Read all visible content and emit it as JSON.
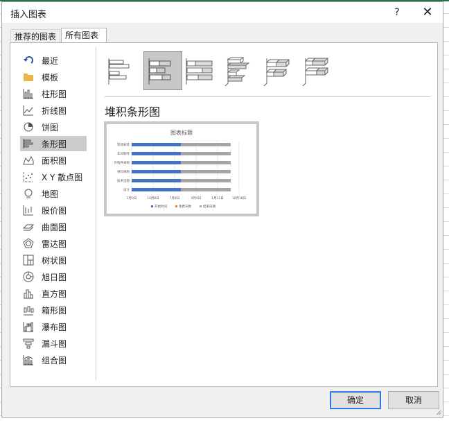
{
  "dialog": {
    "title": "插入图表",
    "help_label": "?",
    "close_label": "✕"
  },
  "tabs": [
    {
      "label": "推荐的图表",
      "active": false
    },
    {
      "label": "所有图表",
      "active": true
    }
  ],
  "categories": [
    {
      "label": "最近",
      "icon": "recent-icon"
    },
    {
      "label": "模板",
      "icon": "folder-icon"
    },
    {
      "label": "柱形图",
      "icon": "column-chart-icon"
    },
    {
      "label": "折线图",
      "icon": "line-chart-icon"
    },
    {
      "label": "饼图",
      "icon": "pie-chart-icon"
    },
    {
      "label": "条形图",
      "icon": "bar-chart-icon",
      "selected": true
    },
    {
      "label": "面积图",
      "icon": "area-chart-icon"
    },
    {
      "label": "X Y 散点图",
      "icon": "scatter-chart-icon"
    },
    {
      "label": "地图",
      "icon": "map-chart-icon"
    },
    {
      "label": "股价图",
      "icon": "stock-chart-icon"
    },
    {
      "label": "曲面图",
      "icon": "surface-chart-icon"
    },
    {
      "label": "雷达图",
      "icon": "radar-chart-icon"
    },
    {
      "label": "树状图",
      "icon": "treemap-chart-icon"
    },
    {
      "label": "旭日图",
      "icon": "sunburst-chart-icon"
    },
    {
      "label": "直方图",
      "icon": "histogram-chart-icon"
    },
    {
      "label": "箱形图",
      "icon": "box-whisker-chart-icon"
    },
    {
      "label": "瀑布图",
      "icon": "waterfall-chart-icon"
    },
    {
      "label": "漏斗图",
      "icon": "funnel-chart-icon"
    },
    {
      "label": "组合图",
      "icon": "combo-chart-icon"
    }
  ],
  "subtypes": [
    {
      "name": "clustered-bar",
      "selected": false
    },
    {
      "name": "stacked-bar",
      "selected": true
    },
    {
      "name": "100-stacked-bar",
      "selected": false
    },
    {
      "name": "3d-clustered-bar",
      "selected": false
    },
    {
      "name": "3d-stacked-bar",
      "selected": false
    },
    {
      "name": "3d-100-stacked-bar",
      "selected": false
    }
  ],
  "selected_chart_name": "堆积条形图",
  "preview": {
    "title": "图表标题",
    "rows": [
      "现场安装",
      "车间制作",
      "外购件采购",
      "材料采购",
      "技术出图",
      "设计"
    ],
    "x_ticks": [
      "1月0日",
      "10月8日",
      "7月4日",
      "4月0日",
      "1月11日",
      "10月18日"
    ],
    "legend": [
      "开始时间",
      "免费天数",
      "结束日期"
    ],
    "colors": {
      "series1": "#4472c4",
      "series2": "#ed7d31",
      "series3": "#a5a5a5"
    }
  },
  "buttons": {
    "ok": "确定",
    "cancel": "取消"
  }
}
